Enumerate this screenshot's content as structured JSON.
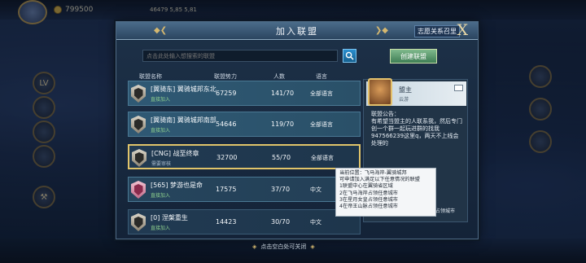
{
  "hud": {
    "resource_amount": "799500",
    "coords_text": "46479 5,85 5,81"
  },
  "panel": {
    "title": "加入联盟",
    "close_glyph": "X",
    "recruit_link": "志愿关系召里",
    "search_placeholder": "点击此处输入想搜索的联盟",
    "create_button": "创建联盟",
    "columns": {
      "name": "联盟名称",
      "power": "联盟势力",
      "members": "人数",
      "language": "语言"
    }
  },
  "alliances": [
    {
      "name": "[翼骑东] 翼骑城邦东北",
      "join_mode": "直接加入",
      "power": "67259",
      "members": "141/70",
      "language": "全部语言"
    },
    {
      "name": "[翼骑南] 翼骑城邦南部",
      "join_mode": "直接加入",
      "power": "54646",
      "members": "119/70",
      "language": "全部语言"
    },
    {
      "name": "[CNG] 战至终章",
      "join_mode": "需要审核",
      "power": "32700",
      "members": "55/70",
      "language": "全部语言"
    },
    {
      "name": "[565] 梦游也是命",
      "join_mode": "直接加入",
      "power": "17575",
      "members": "37/70",
      "language": "中文"
    },
    {
      "name": "[0] 涅槃重生",
      "join_mode": "直接加入",
      "power": "14423",
      "members": "30/70",
      "language": "中文"
    }
  ],
  "info": {
    "leader_title": "盟主",
    "leader_name": "云游",
    "notice": "联盟公告：\n有希望当盟主的人联系我，然后专门创一个群一起玩进群的找我947566239这里q，两天不上线会处理的",
    "footer": "占领城市"
  },
  "tooltip": {
    "lines": [
      "当前位置：飞马海岸-翼骑城邦",
      "可申请加入满足以下任意情况的联盟",
      "1联盟中心在翼骑省区域",
      "2在飞马海岸占领任意城市",
      "3在星月女皇占领任意城市",
      "4在帝王山脉占领任意城市"
    ]
  },
  "hint": "点击空白处可关闭",
  "colors": {
    "accent_gold": "#e0c46a",
    "create_green": "#3f7e55",
    "search_blue": "#2b8fcf"
  }
}
